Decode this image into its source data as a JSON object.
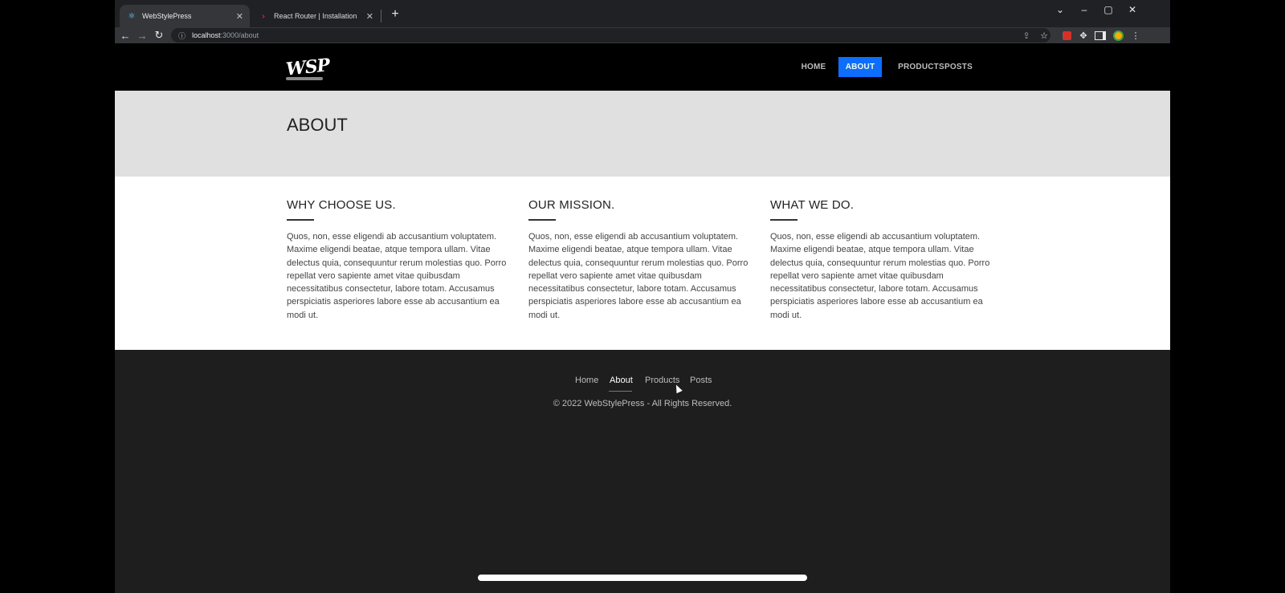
{
  "browser": {
    "tabs": [
      {
        "title": "WebStylePress",
        "active": true,
        "favicon": "react-icon"
      },
      {
        "title": "React Router | Installation",
        "active": false,
        "favicon": "react-router-icon"
      }
    ],
    "url_host": "localhost",
    "url_path": ":3000/about",
    "window_controls": [
      "tab-search",
      "minimize",
      "maximize",
      "close"
    ]
  },
  "site": {
    "logo_text": "WSP",
    "nav": [
      "HOME",
      "ABOUT",
      "PRODUCTS",
      "POSTS"
    ],
    "active_nav": "ABOUT",
    "page_title": "ABOUT",
    "columns": [
      {
        "heading": "WHY CHOOSE US.",
        "text": "Quos, non, esse eligendi ab accusantium voluptatem. Maxime eligendi beatae, atque tempora ullam. Vitae delectus quia, consequuntur rerum molestias quo. Porro repellat vero sapiente amet vitae quibusdam necessitatibus consectetur, labore totam. Accusamus perspiciatis asperiores labore esse ab accusantium ea modi ut."
      },
      {
        "heading": "OUR MISSION.",
        "text": "Quos, non, esse eligendi ab accusantium voluptatem. Maxime eligendi beatae, atque tempora ullam. Vitae delectus quia, consequuntur rerum molestias quo. Porro repellat vero sapiente amet vitae quibusdam necessitatibus consectetur, labore totam. Accusamus perspiciatis asperiores labore esse ab accusantium ea modi ut."
      },
      {
        "heading": "WHAT WE DO.",
        "text": "Quos, non, esse eligendi ab accusantium voluptatem. Maxime eligendi beatae, atque tempora ullam. Vitae delectus quia, consequuntur rerum molestias quo. Porro repellat vero sapiente amet vitae quibusdam necessitatibus consectetur, labore totam. Accusamus perspiciatis asperiores labore esse ab accusantium ea modi ut."
      }
    ],
    "footer_nav": [
      "Home",
      "About",
      "Products",
      "Posts"
    ],
    "footer_active": "About",
    "copyright": "© 2022 WebStylePress - All Rights Reserved."
  },
  "colors": {
    "accent": "#0d6efd",
    "header_bg": "#000000",
    "banner_bg": "#e0e0e0",
    "footer_bg": "#1e1e1e"
  }
}
